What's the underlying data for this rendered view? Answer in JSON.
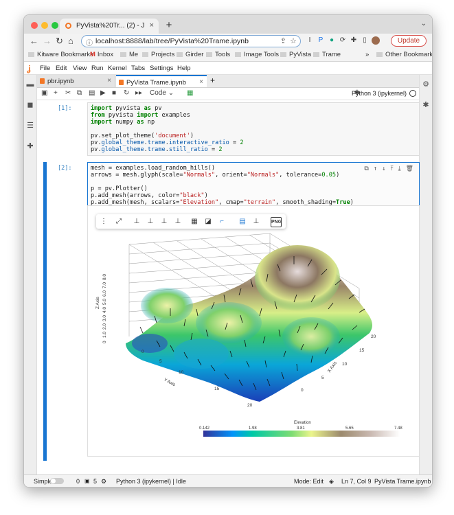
{
  "browser": {
    "tab_title": "PyVista%20Tr... (2) - JupyterLab",
    "url": "localhost:8888/lab/tree/PyVista%20Trame.ipynb",
    "update_label": "Update",
    "bookmarks": [
      "Kitware Bookmarks",
      "Inbox",
      "Me",
      "Projects",
      "Girder",
      "Tools",
      "Image Tools",
      "PyVista",
      "Trame"
    ],
    "other_bookmarks": "Other Bookmarks",
    "more_bookmarks": "»"
  },
  "lab": {
    "menu": [
      "File",
      "Edit",
      "View",
      "Run",
      "Kernel",
      "Tabs",
      "Settings",
      "Help"
    ],
    "doc_tabs": [
      {
        "label": "pbr.ipynb",
        "active": false
      },
      {
        "label": "PyVista Trame.ipynb",
        "active": true
      }
    ],
    "cell_type": "Code",
    "kernel_name": "Python 3 (ipykernel)"
  },
  "cells": [
    {
      "prompt": "[1]:",
      "lines": [
        "import pyvista as pv",
        "from pyvista import examples",
        "import numpy as np",
        "",
        "pv.set_plot_theme('document')",
        "pv.global_theme.trame.interactive_ratio = 2",
        "pv.global_theme.trame.still_ratio = 2"
      ]
    },
    {
      "prompt": "[2]:",
      "lines": [
        "mesh = examples.load_random_hills()",
        "arrows = mesh.glyph(scale=\"Normals\", orient=\"Normals\", tolerance=0.05)",
        "",
        "p = pv.Plotter()",
        "p.add_mesh(arrows, color=\"black\")",
        "p.add_mesh(mesh, scalars=\"Elevation\", cmap=\"terrain\", smooth_shading=True)",
        "p.show()"
      ]
    }
  ],
  "plot": {
    "z_axis_label": "Z Axis",
    "z_ticks": [
      "0",
      "1.0",
      "2.0",
      "3.0",
      "4.0",
      "5.0",
      "6.0",
      "7.0",
      "8.0"
    ],
    "x_axis_label": "X Axis",
    "x_ticks": [
      "0",
      "5",
      "10",
      "15",
      "20"
    ],
    "y_axis_label": "Y Axis",
    "y_ticks": [
      "0",
      "5",
      "10",
      "15",
      "20"
    ],
    "colorbar_title": "Elevation",
    "colorbar_ticks": [
      "0.142",
      "1.98",
      "3.81",
      "5.65",
      "7.48"
    ],
    "colormap": "terrain",
    "colormap_colors": [
      "#333399",
      "#0294fa",
      "#20c66b",
      "#ebf58c",
      "#9c8a6d",
      "#806a60",
      "#ffffff"
    ]
  },
  "status": {
    "mode_label": "Simple",
    "count1": "0",
    "count2": "5",
    "kernel_status": "Python 3 (ipykernel) | Idle",
    "mode": "Mode: Edit",
    "position": "Ln 7, Col 9",
    "file": "PyVista Trame.ipynb"
  }
}
